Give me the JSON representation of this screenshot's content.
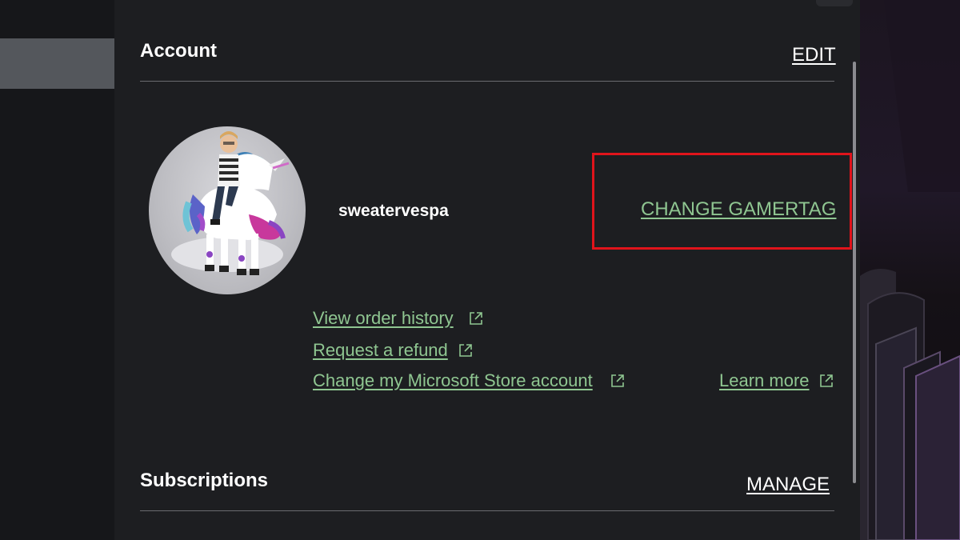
{
  "account": {
    "title": "Account",
    "edit_label": "EDIT",
    "gamertag": "sweatervespa",
    "change_gamertag_label": "CHANGE GAMERTAG",
    "links": {
      "view_order_history": "View order history",
      "request_refund": "Request a refund",
      "change_store_account": "Change my Microsoft Store account",
      "learn_more": "Learn more"
    }
  },
  "subscriptions": {
    "title": "Subscriptions",
    "manage_label": "MANAGE"
  },
  "colors": {
    "link_green": "#8fc691",
    "highlight_red": "#e0141b",
    "panel_bg": "#1d1e21"
  },
  "icons": {
    "external_link": "external-link-icon",
    "avatar": "unicorn-rider-avatar"
  }
}
